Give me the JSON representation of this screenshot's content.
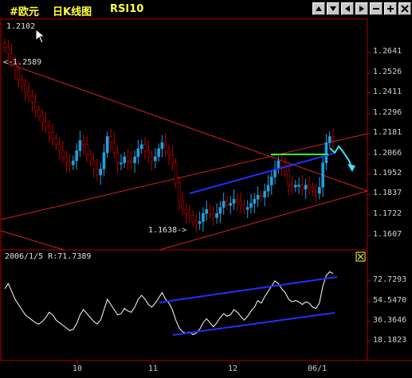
{
  "window": {
    "symbol": "#欧元",
    "period": "日K线图",
    "indicator": "RSI10",
    "buttons": [
      "prev-up",
      "prev-down",
      "scroll-left",
      "scroll-right",
      "zoom-out",
      "zoom-in",
      "close"
    ]
  },
  "colors": {
    "up_candle": "#20a0e0",
    "down_candle": "#c00000",
    "channel_red": "#d02020",
    "trend_blue": "#2030ff",
    "green_line": "#30ff30",
    "arrow_cyan": "#40e0ff",
    "rsi_line": "#ffffff",
    "title_yellow": "#ffff40"
  },
  "price_pane": {
    "cursor_price": "1.2102",
    "high_marker": "1.2589",
    "low_marker": "1.1638",
    "axis_ticks": [
      "1.2641",
      "1.2526",
      "1.2411",
      "1.2296",
      "1.2181",
      "1.2066",
      "1.1952",
      "1.1837",
      "1.1722",
      "1.1607"
    ]
  },
  "rsi_pane": {
    "header": "2006/1/5  R:71.7389",
    "axis_ticks": [
      "72.7293",
      "54.5470",
      "36.3646",
      "18.1823"
    ]
  },
  "time_axis": {
    "labels": [
      "10",
      "11",
      "12",
      "06/1"
    ]
  },
  "chart_data": {
    "type": "candlestick",
    "series_price": [
      1.256,
      1.253,
      1.249,
      1.245,
      1.24,
      1.237,
      1.234,
      1.232,
      1.229,
      1.225,
      1.222,
      1.219,
      1.217,
      1.214,
      1.211,
      1.208,
      1.205,
      1.202,
      1.199,
      1.198,
      1.2,
      1.205,
      1.21,
      1.208,
      1.203,
      1.2,
      1.196,
      1.193,
      1.196,
      1.204,
      1.212,
      1.209,
      1.204,
      1.199,
      1.199,
      1.202,
      1.2,
      1.199,
      1.202,
      1.206,
      1.208,
      1.205,
      1.202,
      1.2,
      1.202,
      1.206,
      1.209,
      1.205,
      1.203,
      1.199,
      1.189,
      1.18,
      1.176,
      1.174,
      1.173,
      1.17,
      1.169,
      1.17,
      1.174,
      1.176,
      1.174,
      1.172,
      1.174,
      1.177,
      1.18,
      1.178,
      1.179,
      1.181,
      1.18,
      1.178,
      1.176,
      1.177,
      1.179,
      1.181,
      1.183,
      1.182,
      1.185,
      1.188,
      1.192,
      1.196,
      1.2,
      1.197,
      1.195,
      1.188,
      1.187,
      1.188,
      1.188,
      1.186,
      1.188,
      1.187,
      1.185,
      1.184,
      1.187,
      1.199,
      1.209,
      1.212,
      1.2102
    ],
    "series_rsi": [
      60,
      64,
      58,
      52,
      48,
      44,
      40,
      38,
      36,
      34,
      33,
      35,
      38,
      42,
      40,
      36,
      34,
      32,
      30,
      28,
      29,
      33,
      40,
      44,
      41,
      38,
      35,
      33,
      36,
      44,
      52,
      48,
      44,
      40,
      41,
      45,
      43,
      42,
      46,
      52,
      55,
      52,
      48,
      46,
      49,
      53,
      57,
      52,
      49,
      44,
      36,
      30,
      27,
      26,
      27,
      25,
      26,
      29,
      34,
      37,
      34,
      31,
      34,
      38,
      41,
      39,
      40,
      44,
      42,
      39,
      36,
      39,
      43,
      46,
      51,
      49,
      54,
      58,
      62,
      66,
      64,
      60,
      57,
      52,
      50,
      51,
      50,
      48,
      50,
      49,
      46,
      45,
      49,
      62,
      70,
      73,
      71.7389
    ],
    "ylim_price": [
      1.156,
      1.27
    ],
    "ylim_rsi": [
      10,
      80
    ]
  }
}
